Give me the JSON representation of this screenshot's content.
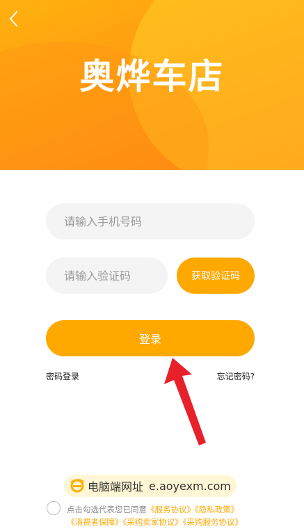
{
  "header": {
    "back_icon": "chevron-left-icon",
    "logo_text": "奥烨车店"
  },
  "form": {
    "phone_placeholder": "请输入手机号码",
    "code_placeholder": "请输入验证码",
    "get_code_label": "获取验证码",
    "login_label": "登录",
    "password_login_label": "密码登录",
    "forgot_password_label": "忘记密码?"
  },
  "watermark": {
    "icon": "ie-logo-icon",
    "label": "电脑端网址",
    "url": "e.aoyexm.com"
  },
  "agreement": {
    "prefix": "点击勾选代表您已同意",
    "links": [
      "《服务协议》",
      "《隐私政策》",
      "《消费者保障》",
      "《采购卖家协议》",
      "《采购服务协议》"
    ]
  },
  "colors": {
    "accent": "#ffa800",
    "hero_gradient_start": "#ffb20f",
    "hero_gradient_end": "#ff7d12",
    "arrow": "#e8202a"
  }
}
